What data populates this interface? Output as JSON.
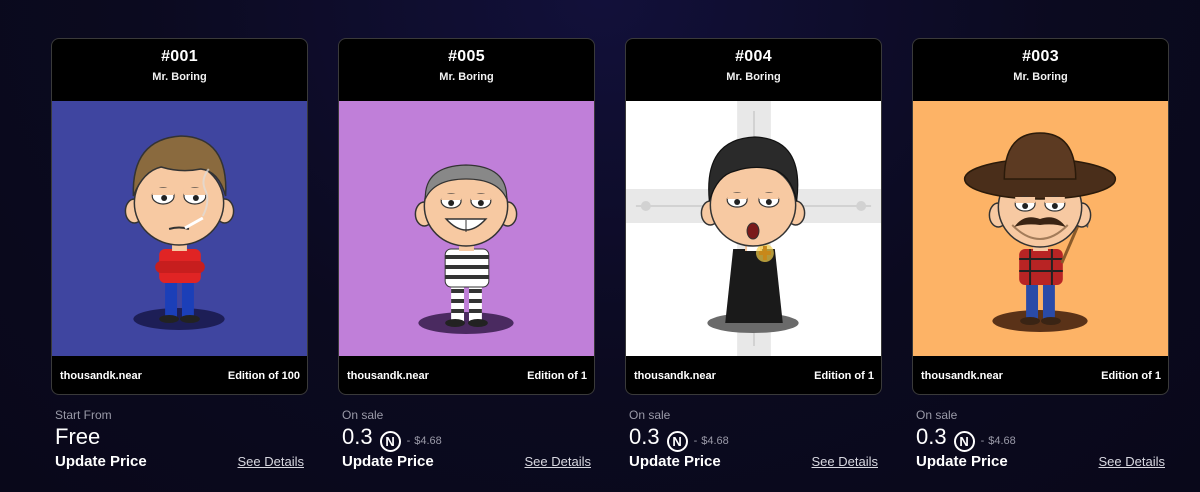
{
  "cards": [
    {
      "number": "#001",
      "series": "Mr. Boring",
      "owner": "thousandk.near",
      "edition": "Edition of 100",
      "price_label": "Start From",
      "price": "Free",
      "price_usd": "",
      "show_near": false,
      "update_label": "Update Price",
      "details_label": "See Details",
      "bg_color": "#3f45a0",
      "character": "smoker"
    },
    {
      "number": "#005",
      "series": "Mr. Boring",
      "owner": "thousandk.near",
      "edition": "Edition of 1",
      "price_label": "On sale",
      "price": "0.3",
      "price_usd": "$4.68",
      "show_near": true,
      "update_label": "Update Price",
      "details_label": "See Details",
      "bg_color": "#c07fd9",
      "character": "prisoner"
    },
    {
      "number": "#004",
      "series": "Mr. Boring",
      "owner": "thousandk.near",
      "edition": "Edition of 1",
      "price_label": "On sale",
      "price": "0.3",
      "price_usd": "$4.68",
      "show_near": true,
      "update_label": "Update Price",
      "details_label": "See Details",
      "bg_color": "#ffffff",
      "character": "priest"
    },
    {
      "number": "#003",
      "series": "Mr. Boring",
      "owner": "thousandk.near",
      "edition": "Edition of 1",
      "price_label": "On sale",
      "price": "0.3",
      "price_usd": "$4.68",
      "show_near": true,
      "update_label": "Update Price",
      "details_label": "See Details",
      "bg_color": "#fdb366",
      "character": "lumberjack"
    }
  ],
  "near_symbol": "N",
  "usd_dash": "-"
}
